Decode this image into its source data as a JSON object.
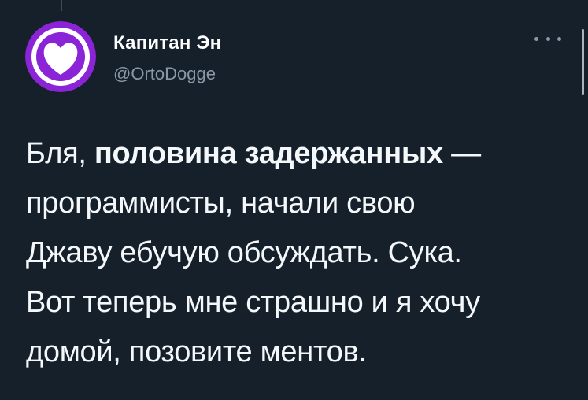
{
  "tweet": {
    "author_name": "Капитан Эн",
    "author_handle": "@OrtoDogge",
    "text_lines": [
      {
        "before": "Бля, ",
        "bold": "половина задержанных",
        "after": " —"
      },
      {
        "text": "программисты, начали свою"
      },
      {
        "text": "Джаву ебучую обсуждать. Сука."
      },
      {
        "text": "Вот теперь мне страшно и я хочу"
      },
      {
        "text": "домой, позовите ментов."
      }
    ]
  },
  "icons": {
    "avatar": "heart-avatar-icon",
    "more": "more-options-icon"
  },
  "colors": {
    "background": "#15202b",
    "avatar_purple": "#8a24d6",
    "handle_gray": "#8b98a5",
    "text_white": "#f5f8fa"
  }
}
